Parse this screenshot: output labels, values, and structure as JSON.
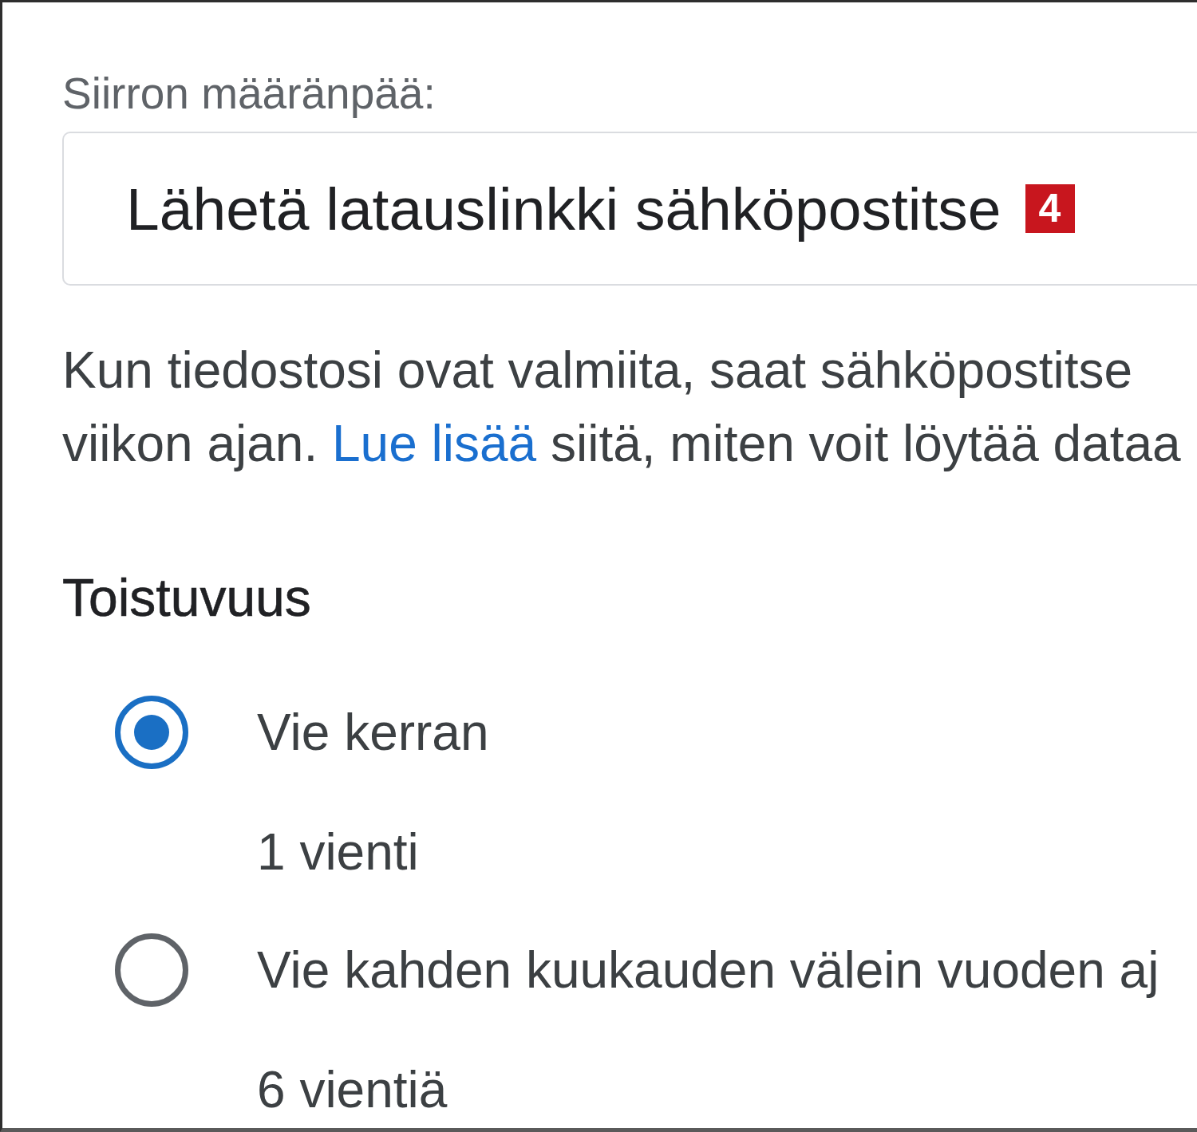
{
  "destination": {
    "label": "Siirron määränpää:",
    "value": "Lähetä latauslinkki sähköpostitse",
    "badge": "4"
  },
  "description": {
    "line_1": "Kun tiedostosi ovat valmiita, saat sähköpostitse",
    "line_2_start": "viikon ajan.",
    "link": "Lue lisää",
    "line_2_end": "siitä, miten voit löytää dataa"
  },
  "frequency": {
    "title": "Toistuvuus",
    "options": [
      {
        "label": "Vie kerran",
        "detail": "1 vienti",
        "selected": true
      },
      {
        "label": "Vie kahden kuukauden välein vuoden aj",
        "detail": "6 vientiä",
        "selected": false
      }
    ]
  }
}
